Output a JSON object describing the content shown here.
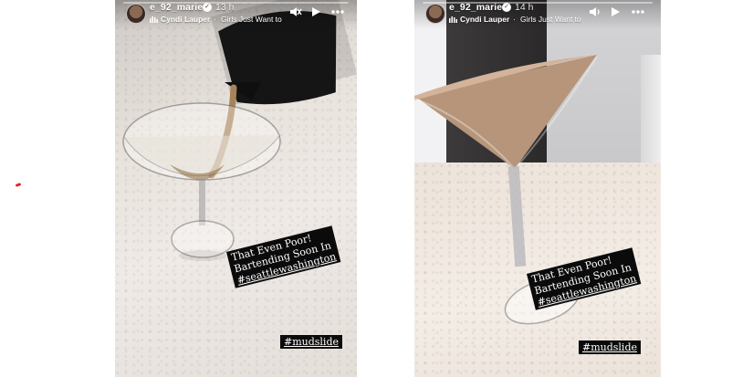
{
  "stories": [
    {
      "username": "e_92_marie",
      "timestamp": "13 h",
      "music": {
        "artist": "Cyndi Lauper",
        "separator": "·",
        "song": "Girls Just Want to"
      },
      "caption_lines": [
        "That Even Poor!",
        "Bartending Soon In",
        "#seattlewashington"
      ],
      "hashtag": "#mudslide"
    },
    {
      "username": "e_92_marie",
      "timestamp": "14 h",
      "music": {
        "artist": "Cyndi Lauper",
        "separator": "·",
        "song": "Girls Just Want to"
      },
      "caption_lines": [
        "That Even Poor!",
        "Bartending Soon In",
        "#seattlewashington"
      ],
      "hashtag": "#mudslide"
    }
  ],
  "icons": {
    "verified": "verified-badge-icon",
    "music": "music-bars-icon",
    "mute": "speaker-muted-icon",
    "sound": "speaker-on-icon",
    "play": "play-icon",
    "more": "more-horizontal-icon"
  }
}
